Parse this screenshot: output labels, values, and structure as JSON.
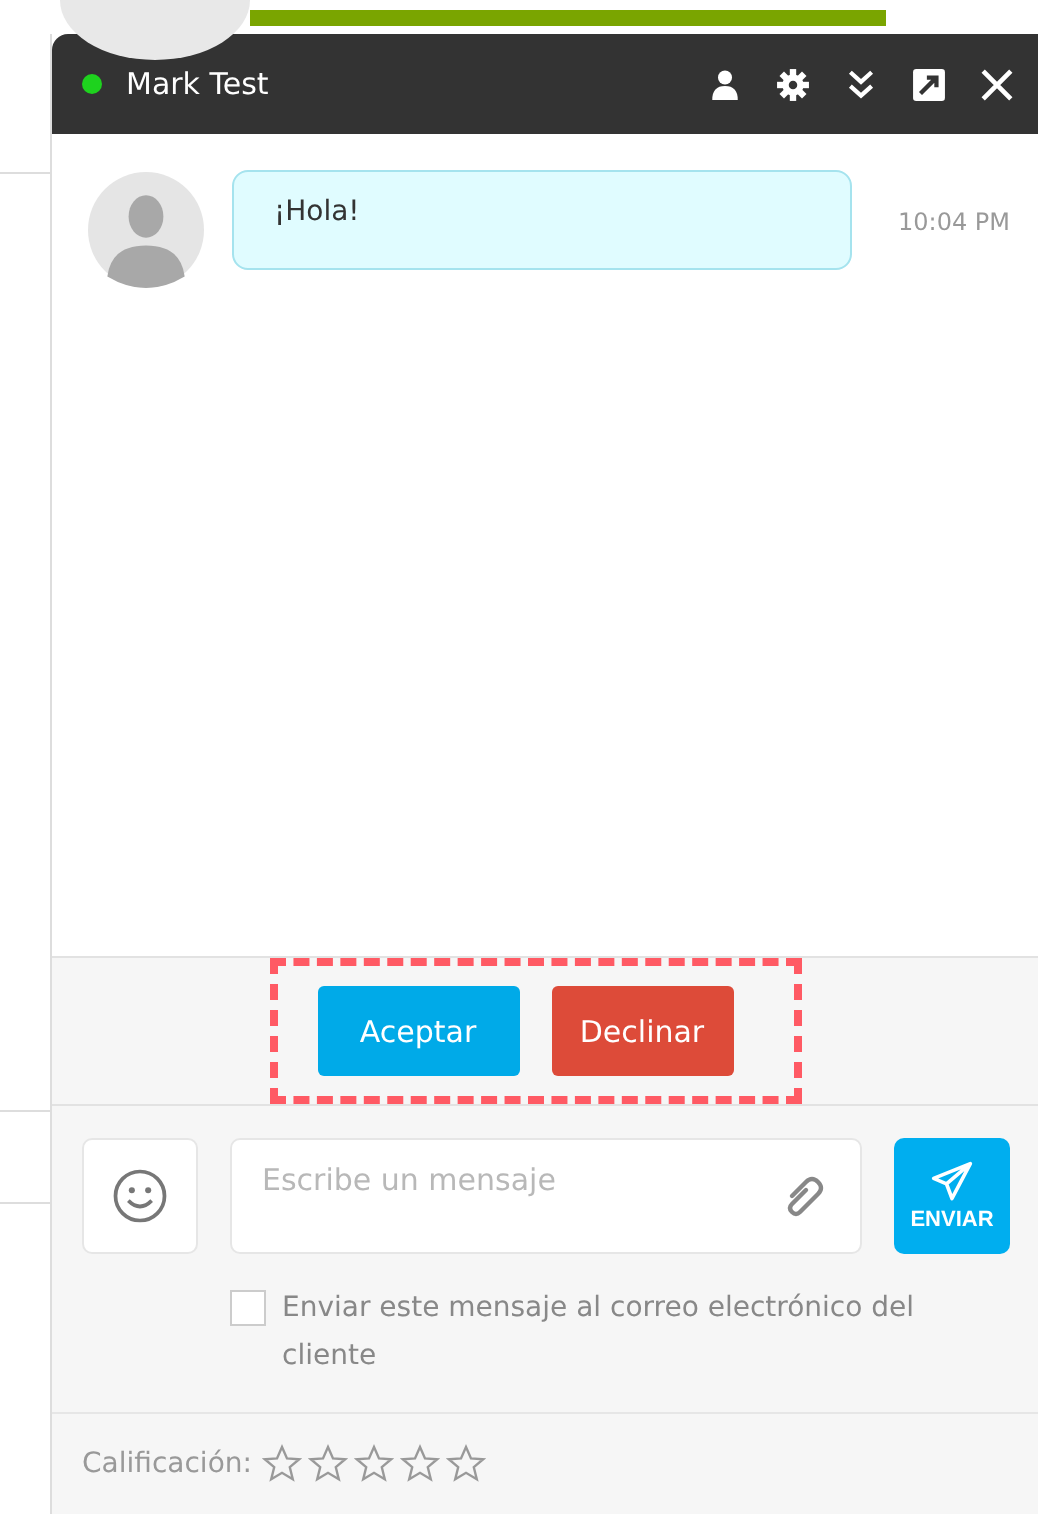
{
  "chat": {
    "contact": "Mark Test",
    "online": true
  },
  "messages": [
    {
      "text": "¡Hola!",
      "time": "10:04 PM"
    }
  ],
  "actions": [
    {
      "label": "Aceptar",
      "kind": "accept"
    },
    {
      "label": "Declinar",
      "kind": "decline"
    }
  ],
  "composer": {
    "placeholder": "Escribe un mensaje",
    "send": "ENVIAR"
  },
  "email_option": {
    "label": "Enviar este mensaje al correo electrónico del cliente",
    "checked": false
  },
  "rating": {
    "label": "Calificación:",
    "stars": 0
  }
}
